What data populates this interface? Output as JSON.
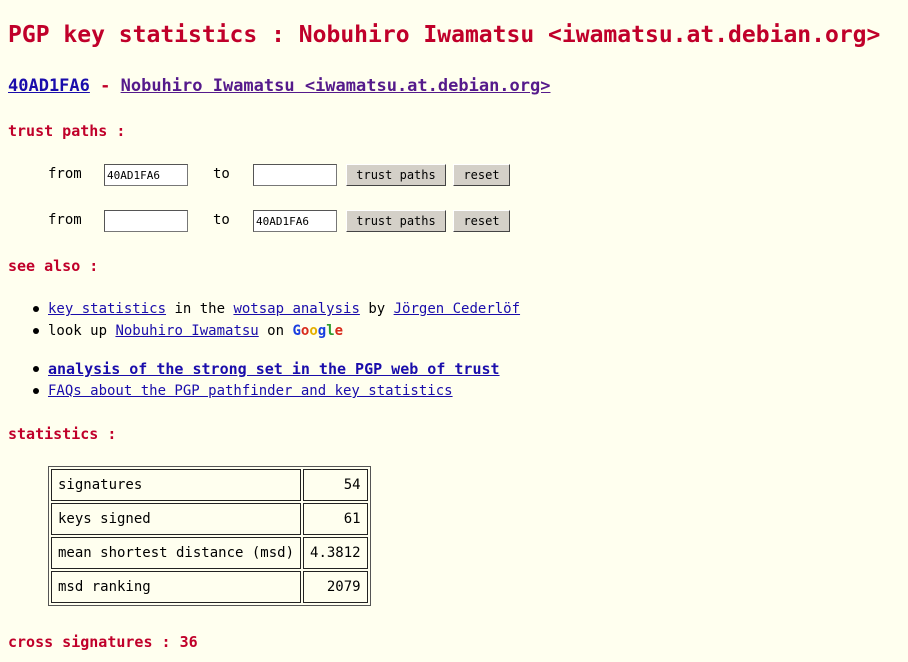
{
  "title": "PGP key statistics : Nobuhiro Iwamatsu <iwamatsu.at.debian.org>",
  "key": {
    "id": "40AD1FA6",
    "separator": " - ",
    "name": "Nobuhiro Iwamatsu <iwamatsu.at.debian.org>"
  },
  "trust_paths": {
    "heading": "trust paths :",
    "rows": [
      {
        "from_label": "from",
        "from_value": "40AD1FA6",
        "to_label": "to",
        "to_value": "",
        "submit": "trust paths",
        "reset": "reset"
      },
      {
        "from_label": "from",
        "from_value": "",
        "to_label": "to",
        "to_value": "40AD1FA6",
        "submit": "trust paths",
        "reset": "reset"
      }
    ]
  },
  "see_also": {
    "heading": "see also :",
    "item1": {
      "link1": "key statistics",
      "text1": " in the ",
      "link2": "wotsap analysis",
      "text2": " by ",
      "link3": "Jörgen Cederlöf"
    },
    "item2": {
      "text1": "look up ",
      "link1": "Nobuhiro Iwamatsu",
      "text2": " on ",
      "google": [
        "G",
        "o",
        "o",
        "g",
        "l",
        "e"
      ]
    },
    "item3": {
      "link1": "analysis of the strong set in the PGP web of trust"
    },
    "item4": {
      "link1": "FAQs about the PGP pathfinder and key statistics"
    }
  },
  "statistics": {
    "heading": "statistics :",
    "rows": [
      {
        "label": "signatures",
        "value": "54"
      },
      {
        "label": "keys signed",
        "value": "61"
      },
      {
        "label": "mean shortest distance (msd)",
        "value": "4.3812"
      },
      {
        "label": "msd ranking",
        "value": "2079"
      }
    ]
  },
  "cross_signatures": "cross signatures : 36"
}
